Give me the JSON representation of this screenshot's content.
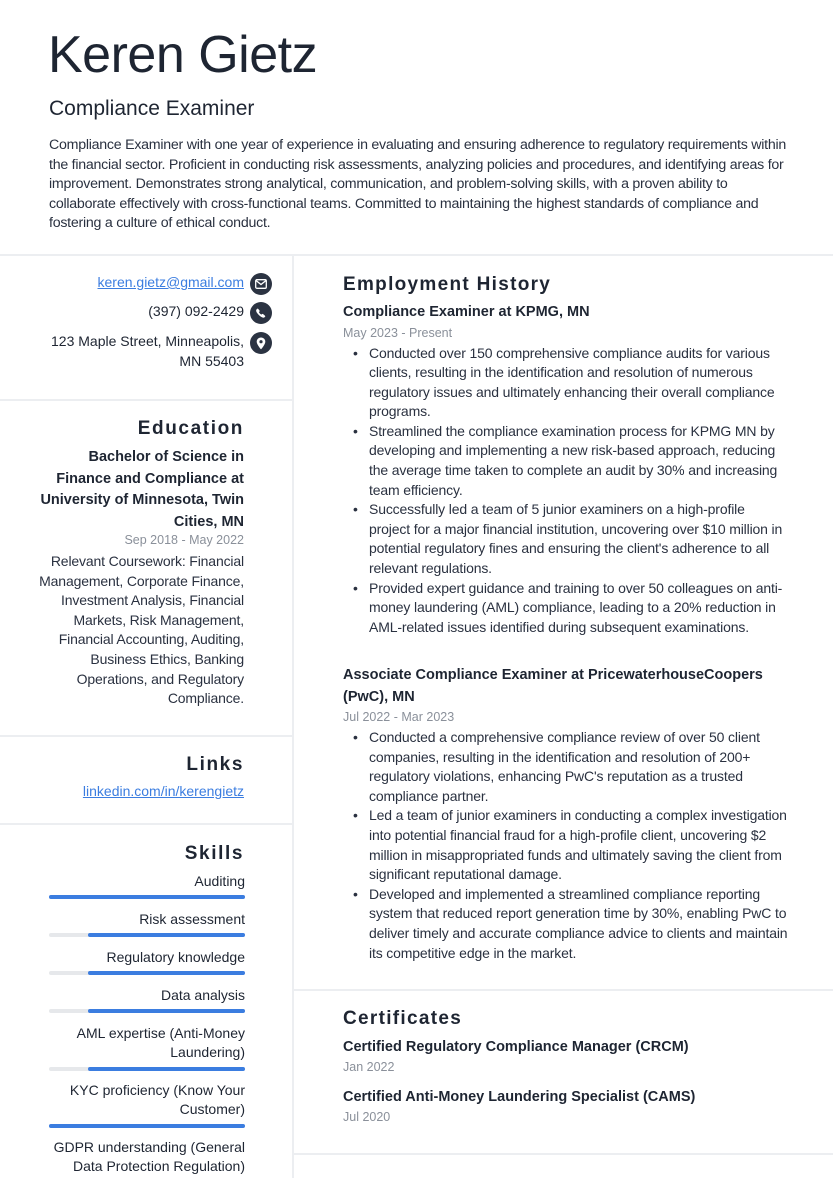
{
  "header": {
    "name": "Keren Gietz",
    "title": "Compliance Examiner",
    "summary": "Compliance Examiner with one year of experience in evaluating and ensuring adherence to regulatory requirements within the financial sector. Proficient in conducting risk assessments, analyzing policies and procedures, and identifying areas for improvement. Demonstrates strong analytical, communication, and problem-solving skills, with a proven ability to collaborate effectively with cross-functional teams. Committed to maintaining the highest standards of compliance and fostering a culture of ethical conduct."
  },
  "contact": {
    "email": "keren.gietz@gmail.com",
    "email_icon": "envelope-icon",
    "phone": "(397) 092-2429",
    "phone_icon": "phone-icon",
    "address": "123 Maple Street, Minneapolis, MN 55403",
    "address_icon": "map-pin-icon"
  },
  "education": {
    "heading": "Education",
    "degree": "Bachelor of Science in Finance and Compliance at University of Minnesota, Twin Cities, MN",
    "dates": "Sep 2018 - May 2022",
    "description": "Relevant Coursework: Financial Management, Corporate Finance, Investment Analysis, Financial Markets, Risk Management, Financial Accounting, Auditing, Business Ethics, Banking Operations, and Regulatory Compliance."
  },
  "links": {
    "heading": "Links",
    "items": [
      {
        "label": "linkedin.com/in/kerengietz"
      }
    ]
  },
  "skills": {
    "heading": "Skills",
    "items": [
      {
        "label": "Auditing",
        "level_percent": 100
      },
      {
        "label": "Risk assessment",
        "level_percent": 80
      },
      {
        "label": "Regulatory knowledge",
        "level_percent": 80
      },
      {
        "label": "Data analysis",
        "level_percent": 80
      },
      {
        "label": "AML expertise (Anti-Money Laundering)",
        "level_percent": 80
      },
      {
        "label": "KYC proficiency (Know Your Customer)",
        "level_percent": 100
      },
      {
        "label": "GDPR understanding (General Data Protection Regulation)",
        "level_percent": null
      }
    ]
  },
  "employment": {
    "heading": "Employment History",
    "jobs": [
      {
        "title": "Compliance Examiner at KPMG, MN",
        "dates": "May 2023 - Present",
        "bullets": [
          "Conducted over 150 comprehensive compliance audits for various clients, resulting in the identification and resolution of numerous regulatory issues and ultimately enhancing their overall compliance programs.",
          "Streamlined the compliance examination process for KPMG MN by developing and implementing a new risk-based approach, reducing the average time taken to complete an audit by 30% and increasing team efficiency.",
          "Successfully led a team of 5 junior examiners on a high-profile project for a major financial institution, uncovering over $10 million in potential regulatory fines and ensuring the client's adherence to all relevant regulations.",
          "Provided expert guidance and training to over 50 colleagues on anti-money laundering (AML) compliance, leading to a 20% reduction in AML-related issues identified during subsequent examinations."
        ]
      },
      {
        "title": "Associate Compliance Examiner at PricewaterhouseCoopers (PwC), MN",
        "dates": "Jul 2022 - Mar 2023",
        "bullets": [
          "Conducted a comprehensive compliance review of over 50 client companies, resulting in the identification and resolution of 200+ regulatory violations, enhancing PwC's reputation as a trusted compliance partner.",
          "Led a team of junior examiners in conducting a complex investigation into potential financial fraud for a high-profile client, uncovering $2 million in misappropriated funds and ultimately saving the client from significant reputational damage.",
          "Developed and implemented a streamlined compliance reporting system that reduced report generation time by 30%, enabling PwC to deliver timely and accurate compliance advice to clients and maintain its competitive edge in the market."
        ]
      }
    ]
  },
  "certificates": {
    "heading": "Certificates",
    "items": [
      {
        "name": "Certified Regulatory Compliance Manager (CRCM)",
        "date": "Jan 2022"
      },
      {
        "name": "Certified Anti-Money Laundering Specialist (CAMS)",
        "date": "Jul 2020"
      }
    ]
  },
  "colors": {
    "accent": "#3b7de0",
    "text": "#1e2532",
    "muted": "#8a909a",
    "icon_bg": "#2b3342",
    "divider": "#eceef1",
    "bar_track": "#e6e8eb"
  }
}
